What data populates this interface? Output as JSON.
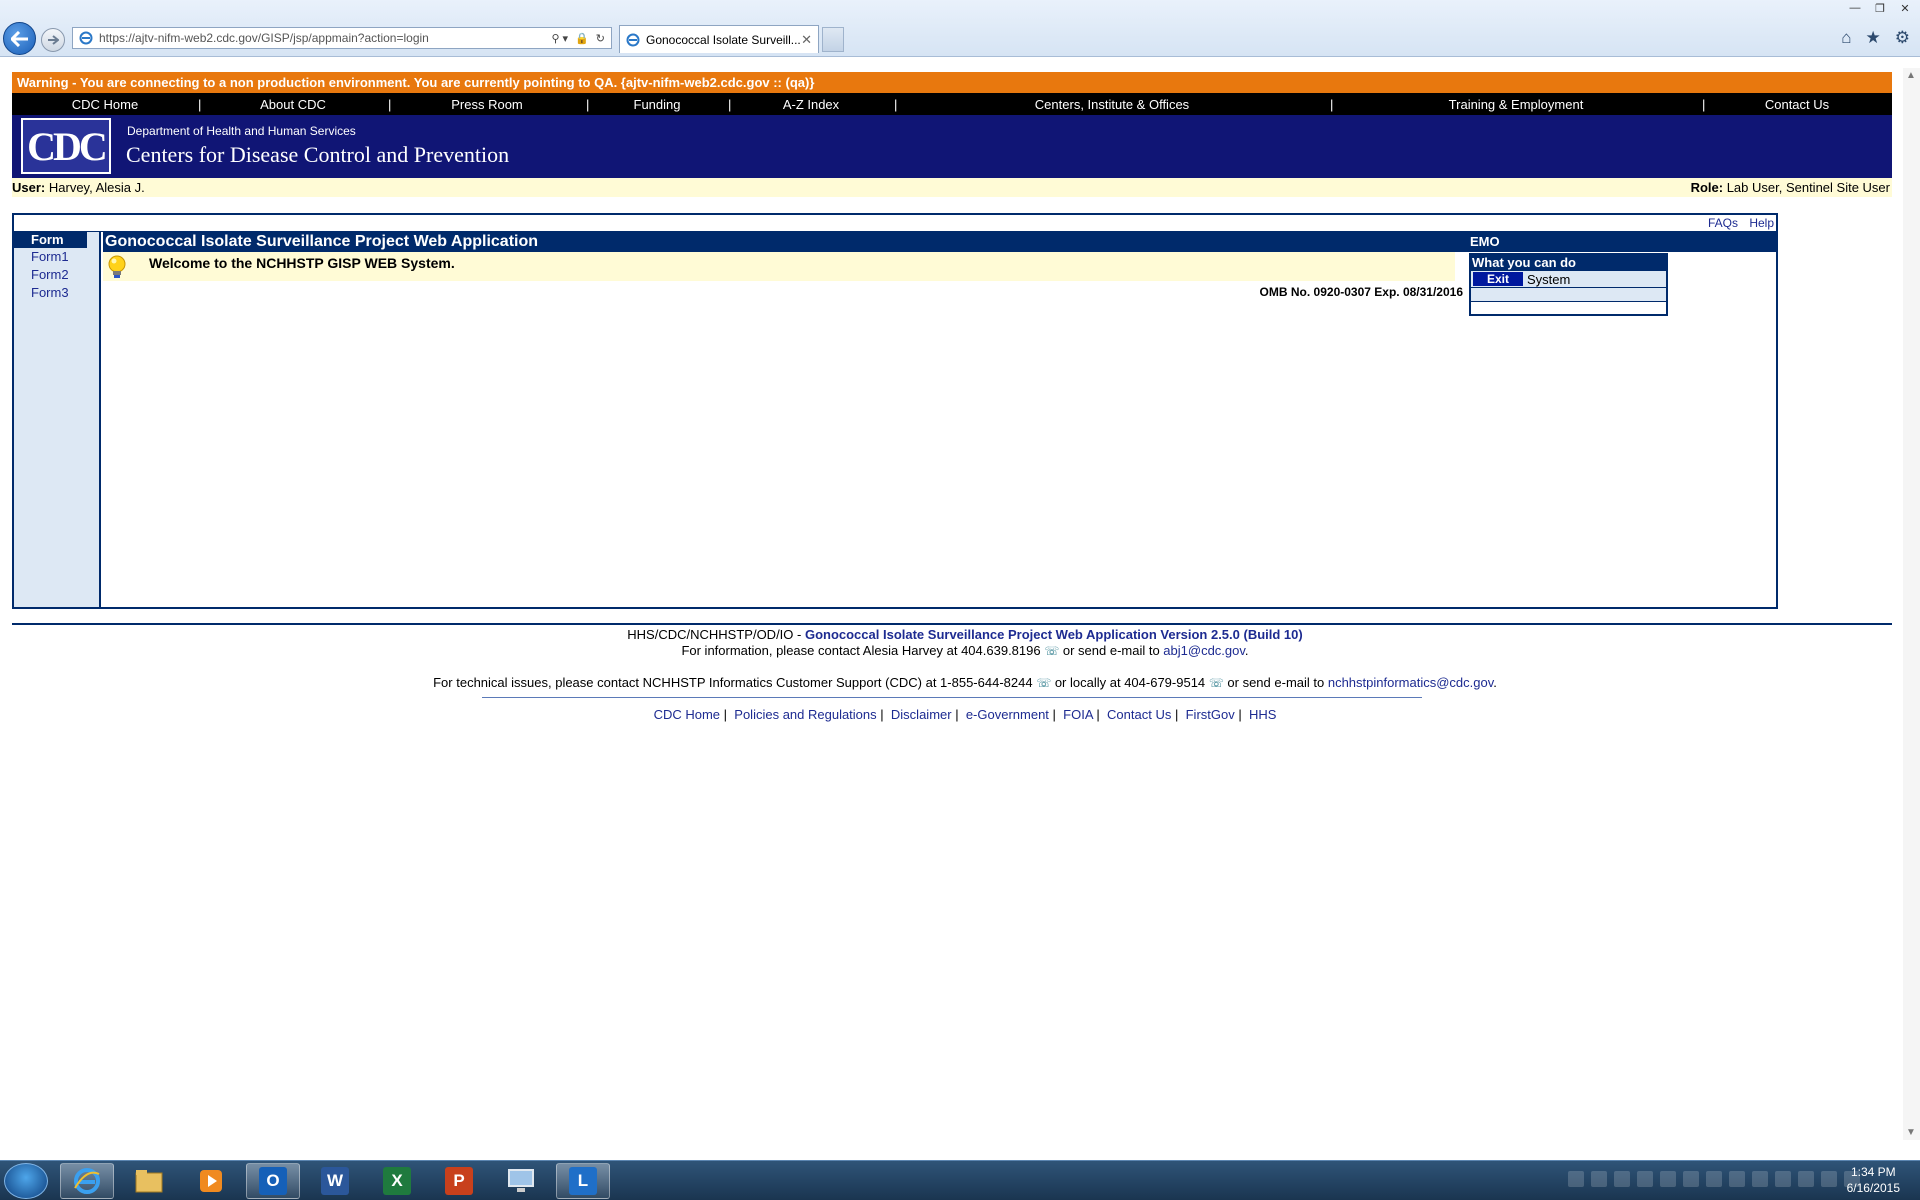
{
  "browser": {
    "url": "https://ajtv-nifm-web2.cdc.gov/GISP/jsp/appmain?action=login",
    "tab_title": "Gonococcal Isolate Surveill...",
    "tab_close": "✕",
    "win_minimize": "—",
    "win_restore": "❐",
    "win_close": "✕",
    "home": "⌂",
    "favorites": "★",
    "settings": "⚙",
    "addr_search": "⚲ ▾",
    "addr_lock": "🔒",
    "addr_refresh": "↻"
  },
  "warning": "Warning - You are connecting to a non production environment. You are currently pointing to QA.   {ajtv-nifm-web2.cdc.gov :: (qa)}",
  "topnav": {
    "items": [
      "CDC Home",
      "About CDC",
      "Press Room",
      "Funding",
      "A-Z Index",
      "Centers, Institute & Offices",
      "Training & Employment",
      "Contact Us"
    ],
    "separator": "|"
  },
  "banner": {
    "logo_text": "CDC",
    "dept": "Department of Health and Human Services",
    "title": "Centers for Disease Control and Prevention"
  },
  "user": {
    "label": "User:",
    "name": "Harvey, Alesia J.",
    "role_label": "Role:",
    "role": "Lab User,  Sentinel Site User"
  },
  "app": {
    "faqs": "FAQs",
    "help": "Help",
    "sidebar": {
      "heading": "Form",
      "items": [
        "Form1",
        "Form2",
        "Form3"
      ]
    },
    "title": "Gonococcal Isolate Surveillance Project Web Application",
    "welcome": "Welcome to the NCHHSTP GISP WEB System.",
    "omb": "OMB No. 0920-0307 Exp. 08/31/2016",
    "emo": {
      "label": "EMO",
      "heading": "What you can do",
      "exit": "Exit",
      "system": "System"
    }
  },
  "footer": {
    "line1_prefix": "HHS/CDC/NCHHSTP/OD/IO - ",
    "line1_app": "Gonococcal Isolate Surveillance Project Web Application Version 2.5.0 (Build 10)",
    "line2_prefix": "For information, please contact Alesia Harvey at 404.639.8196",
    "line2_mid": " or send e-mail to ",
    "line2_email": "abj1@cdc.gov",
    "line3_prefix": "For technical issues, please contact NCHHSTP Informatics Customer Support (CDC) at 1-855-644-8244",
    "line3_mid": " or locally at 404-679-9514",
    "line3_mid2": " or send e-mail to ",
    "line3_email": "nchhstpinformatics@cdc.gov",
    "links": [
      "CDC Home",
      "Policies and Regulations",
      "Disclaimer",
      "e-Government",
      "FOIA",
      "Contact Us",
      "FirstGov",
      "HHS"
    ],
    "link_separator": "|",
    "period": "."
  },
  "taskbar": {
    "word": "W",
    "excel": "X",
    "powerpoint": "P",
    "lync": "L",
    "outlook": "O",
    "time": "1:34 PM",
    "date": "6/16/2015"
  },
  "colors": {
    "warning": "#e8780e",
    "banner": "#101575",
    "header_bar": "#002a6b",
    "link": "#1d2b91"
  }
}
